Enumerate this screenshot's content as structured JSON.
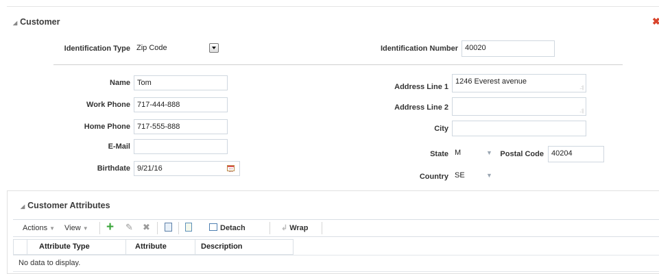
{
  "customer": {
    "title": "Customer",
    "close_icon": "close-icon",
    "identification_type": {
      "label": "Identification Type",
      "value": "Zip Code"
    },
    "identification_number": {
      "label": "Identification Number",
      "value": "40020"
    },
    "name": {
      "label": "Name",
      "value": "Tom"
    },
    "work_phone": {
      "label": "Work Phone",
      "value": "717-444-888"
    },
    "home_phone": {
      "label": "Home Phone",
      "value": "717-555-888"
    },
    "email": {
      "label": "E-Mail",
      "value": ""
    },
    "birthdate": {
      "label": "Birthdate",
      "value": "9/21/16"
    },
    "address_line_1": {
      "label": "Address Line 1",
      "value": "1246 Everest avenue"
    },
    "address_line_2": {
      "label": "Address Line 2",
      "value": ""
    },
    "city": {
      "label": "City",
      "value": ""
    },
    "state": {
      "label": "State",
      "value": "M"
    },
    "postal_code": {
      "label": "Postal Code",
      "value": "40204"
    },
    "country": {
      "label": "Country",
      "value": "SE"
    }
  },
  "attributes": {
    "title": "Customer Attributes",
    "toolbar": {
      "actions": "Actions",
      "view": "View",
      "detach": "Detach",
      "wrap": "Wrap"
    },
    "columns": [
      "Attribute Type",
      "Attribute",
      "Description"
    ],
    "empty_message": "No data to display."
  },
  "colors": {
    "add_icon": "#3aa53a",
    "close_icon": "#d8442c"
  }
}
